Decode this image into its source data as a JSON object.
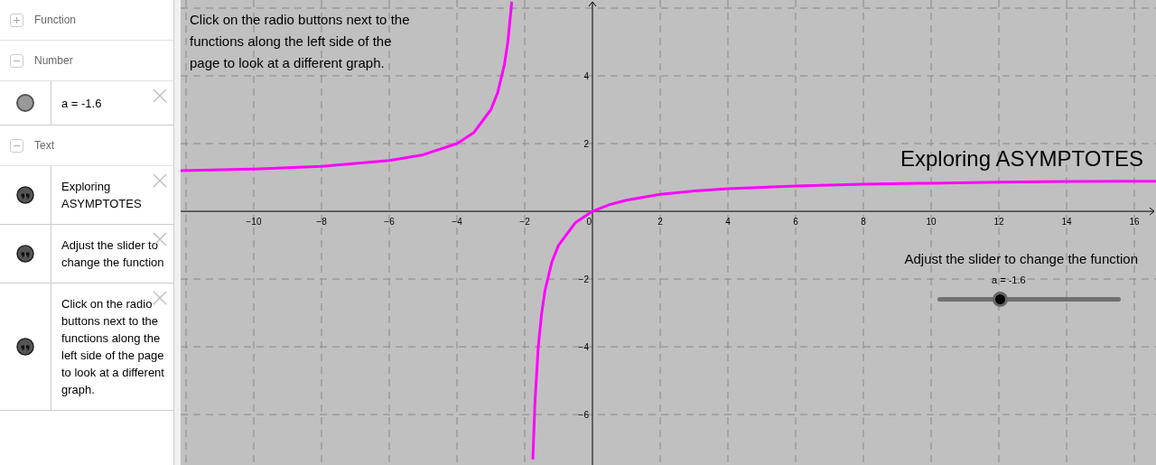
{
  "algebra_view": {
    "sections": [
      {
        "label": "Function",
        "expanded": false
      },
      {
        "label": "Number",
        "expanded": true,
        "items": [
          {
            "kind": "number",
            "text": "a = -1.6"
          }
        ]
      },
      {
        "label": "Text",
        "expanded": true,
        "items": [
          {
            "kind": "text",
            "text": "Exploring ASYMPTOTES"
          },
          {
            "kind": "text",
            "text": "Adjust the slider to change the function"
          },
          {
            "kind": "text",
            "text": "Click on the radio buttons next to the functions along the left side of the  page to look at a different graph."
          }
        ]
      }
    ]
  },
  "graphics_view": {
    "instructions": "Click on the radio buttons next to the functions along the left side of the page to look at a different graph.",
    "title": "Exploring ASYMPTOTES",
    "hint": "Adjust the slider to change the function",
    "slider": {
      "label": "a = -1.6",
      "level": 0.34
    },
    "chart_data": {
      "type": "line",
      "grid": true,
      "xlim": [
        -12.16,
        16.64
      ],
      "ylim": [
        -7.49,
        6.24
      ],
      "xticks": [
        {
          "value": -10,
          "label": "−10"
        },
        {
          "value": -8,
          "label": "−8"
        },
        {
          "value": -6,
          "label": "−6"
        },
        {
          "value": -4,
          "label": "−4"
        },
        {
          "value": -2,
          "label": "−2"
        },
        {
          "value": 0,
          "label": "0"
        },
        2,
        4,
        6,
        8,
        10,
        12,
        14,
        16
      ],
      "yticks": [
        {
          "value": -6,
          "label": "−6"
        },
        {
          "value": -4,
          "label": "−4"
        },
        {
          "value": -2,
          "label": "−2"
        },
        2,
        4
      ],
      "x": [
        -12.16,
        -10,
        -8,
        -6,
        -5,
        -4,
        -3.5,
        -3,
        -2.8,
        -2.6,
        -2.5,
        -2.4,
        -2.385,
        -2,
        -1.76,
        -1.7,
        -1.6,
        -1.5,
        -1.4,
        -1.2,
        -1,
        -0.5,
        0,
        0.5,
        1,
        2,
        3,
        4,
        6,
        8,
        10,
        12,
        14,
        16,
        16.64
      ],
      "series": [
        {
          "color": "#ff00ff",
          "values": [
            1.2,
            1.25,
            1.33,
            1.5,
            1.67,
            2,
            2.33,
            3,
            3.5,
            4.33,
            5,
            6,
            6.19,
            null,
            -7.33,
            -5.67,
            -4,
            -3,
            -2.33,
            -1.5,
            -1,
            -0.33,
            0,
            0.2,
            0.33,
            0.5,
            0.6,
            0.67,
            0.75,
            0.8,
            0.83,
            0.86,
            0.88,
            0.89,
            0.89
          ]
        }
      ]
    }
  }
}
